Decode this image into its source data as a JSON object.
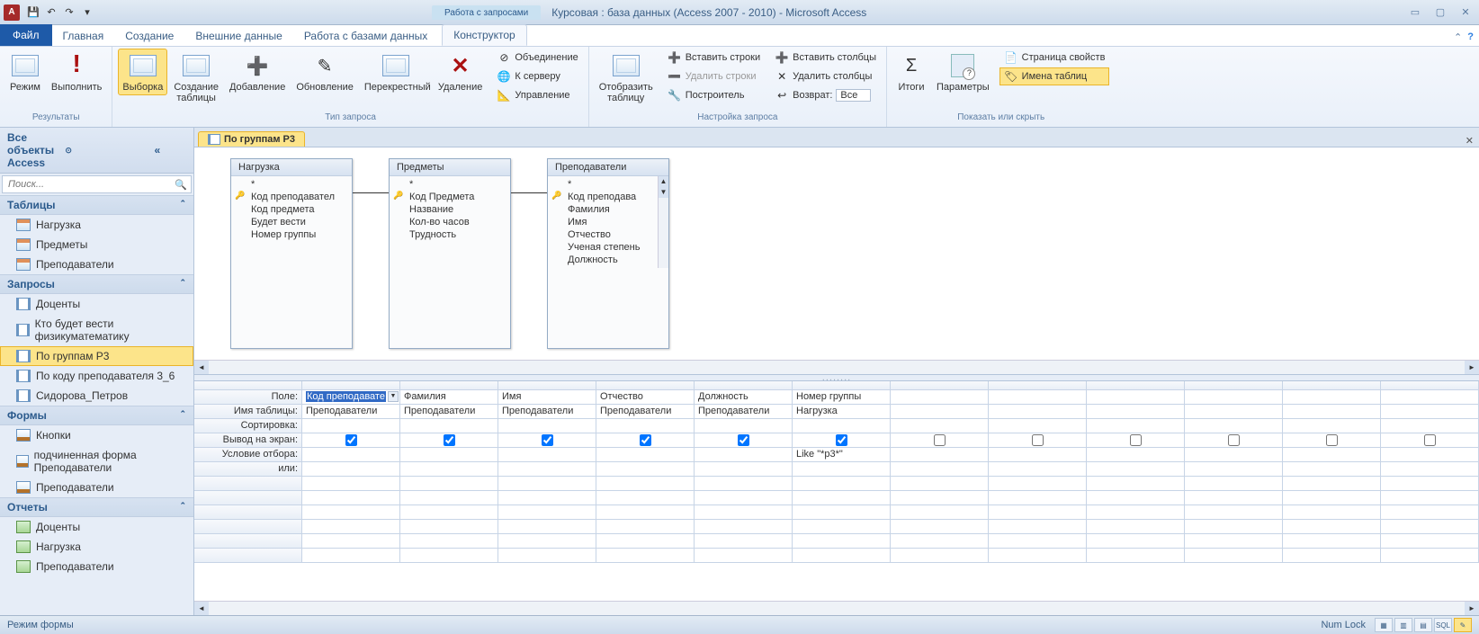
{
  "titlebar": {
    "app_letter": "A",
    "context_tab": "Работа с запросами",
    "window_title": "Курсовая : база данных (Access 2007 - 2010)  -  Microsoft Access"
  },
  "tabs": {
    "file": "Файл",
    "items": [
      "Главная",
      "Создание",
      "Внешние данные",
      "Работа с базами данных"
    ],
    "context_items": [
      "Конструктор"
    ]
  },
  "ribbon": {
    "results": {
      "label": "Результаты",
      "view": "Режим",
      "run": "Выполнить"
    },
    "qtype": {
      "label": "Тип запроса",
      "select": "Выборка",
      "maketable": "Создание\nтаблицы",
      "append": "Добавление",
      "update": "Обновление",
      "crosstab": "Перекрестный",
      "delete": "Удаление",
      "union": "Объединение",
      "passthrough": "К серверу",
      "datadef": "Управление"
    },
    "setup": {
      "label": "Настройка запроса",
      "showtable": "Отобразить\nтаблицу",
      "insert_rows": "Вставить строки",
      "delete_rows": "Удалить строки",
      "builder": "Построитель",
      "insert_cols": "Вставить столбцы",
      "delete_cols": "Удалить столбцы",
      "return": "Возврат:",
      "return_val": "Все"
    },
    "showhide": {
      "label": "Показать или скрыть",
      "totals": "Итоги",
      "params": "Параметры",
      "propsheet": "Страница свойств",
      "tablenames": "Имена таблиц"
    }
  },
  "nav": {
    "header": "Все объекты Access",
    "search_placeholder": "Поиск...",
    "sections": {
      "tables": {
        "label": "Таблицы",
        "items": [
          "Нагрузка",
          "Предметы",
          "Преподаватели"
        ]
      },
      "queries": {
        "label": "Запросы",
        "items": [
          "Доценты",
          "Кто будет вести физикуматематику",
          "По группам Р3",
          "По коду преподавателя 3_6",
          "Сидорова_Петров"
        ],
        "selected": 2
      },
      "forms": {
        "label": "Формы",
        "items": [
          "Кнопки",
          "подчиненная форма Преподаватели",
          "Преподаватели"
        ]
      },
      "reports": {
        "label": "Отчеты",
        "items": [
          "Доценты",
          "Нагрузка",
          "Преподаватели"
        ]
      }
    }
  },
  "document": {
    "tab_label": "По группам Р3",
    "tables": [
      {
        "title": "Нагрузка",
        "fields": [
          "*",
          "Код преподавател",
          "Код предмета",
          "Будет вести",
          "Номер группы"
        ],
        "pk": [
          1
        ]
      },
      {
        "title": "Предметы",
        "fields": [
          "*",
          "Код Предмета",
          "Название",
          "Кол-во часов",
          "Трудность"
        ],
        "pk": [
          1
        ]
      },
      {
        "title": "Преподаватели",
        "fields": [
          "*",
          "Код преподава",
          "Фамилия",
          "Имя",
          "Отчество",
          "Ученая степень",
          "Должность"
        ],
        "pk": [
          1
        ],
        "scroll": true
      }
    ],
    "grid": {
      "row_labels": [
        "Поле:",
        "Имя таблицы:",
        "Сортировка:",
        "Вывод на экран:",
        "Условие отбора:",
        "или:"
      ],
      "cols": [
        {
          "field": "Код преподавате",
          "table": "Преподаватели",
          "show": true,
          "selected": true
        },
        {
          "field": "Фамилия",
          "table": "Преподаватели",
          "show": true
        },
        {
          "field": "Имя",
          "table": "Преподаватели",
          "show": true
        },
        {
          "field": "Отчество",
          "table": "Преподаватели",
          "show": true
        },
        {
          "field": "Должность",
          "table": "Преподаватели",
          "show": true
        },
        {
          "field": "Номер группы",
          "table": "Нагрузка",
          "show": true,
          "criteria": "Like \"*р3*\""
        },
        {
          "show": false
        },
        {
          "show": false
        },
        {
          "show": false
        },
        {
          "show": false
        },
        {
          "show": false
        },
        {
          "show": false
        }
      ]
    }
  },
  "statusbar": {
    "left": "Режим формы",
    "numlock": "Num Lock"
  }
}
